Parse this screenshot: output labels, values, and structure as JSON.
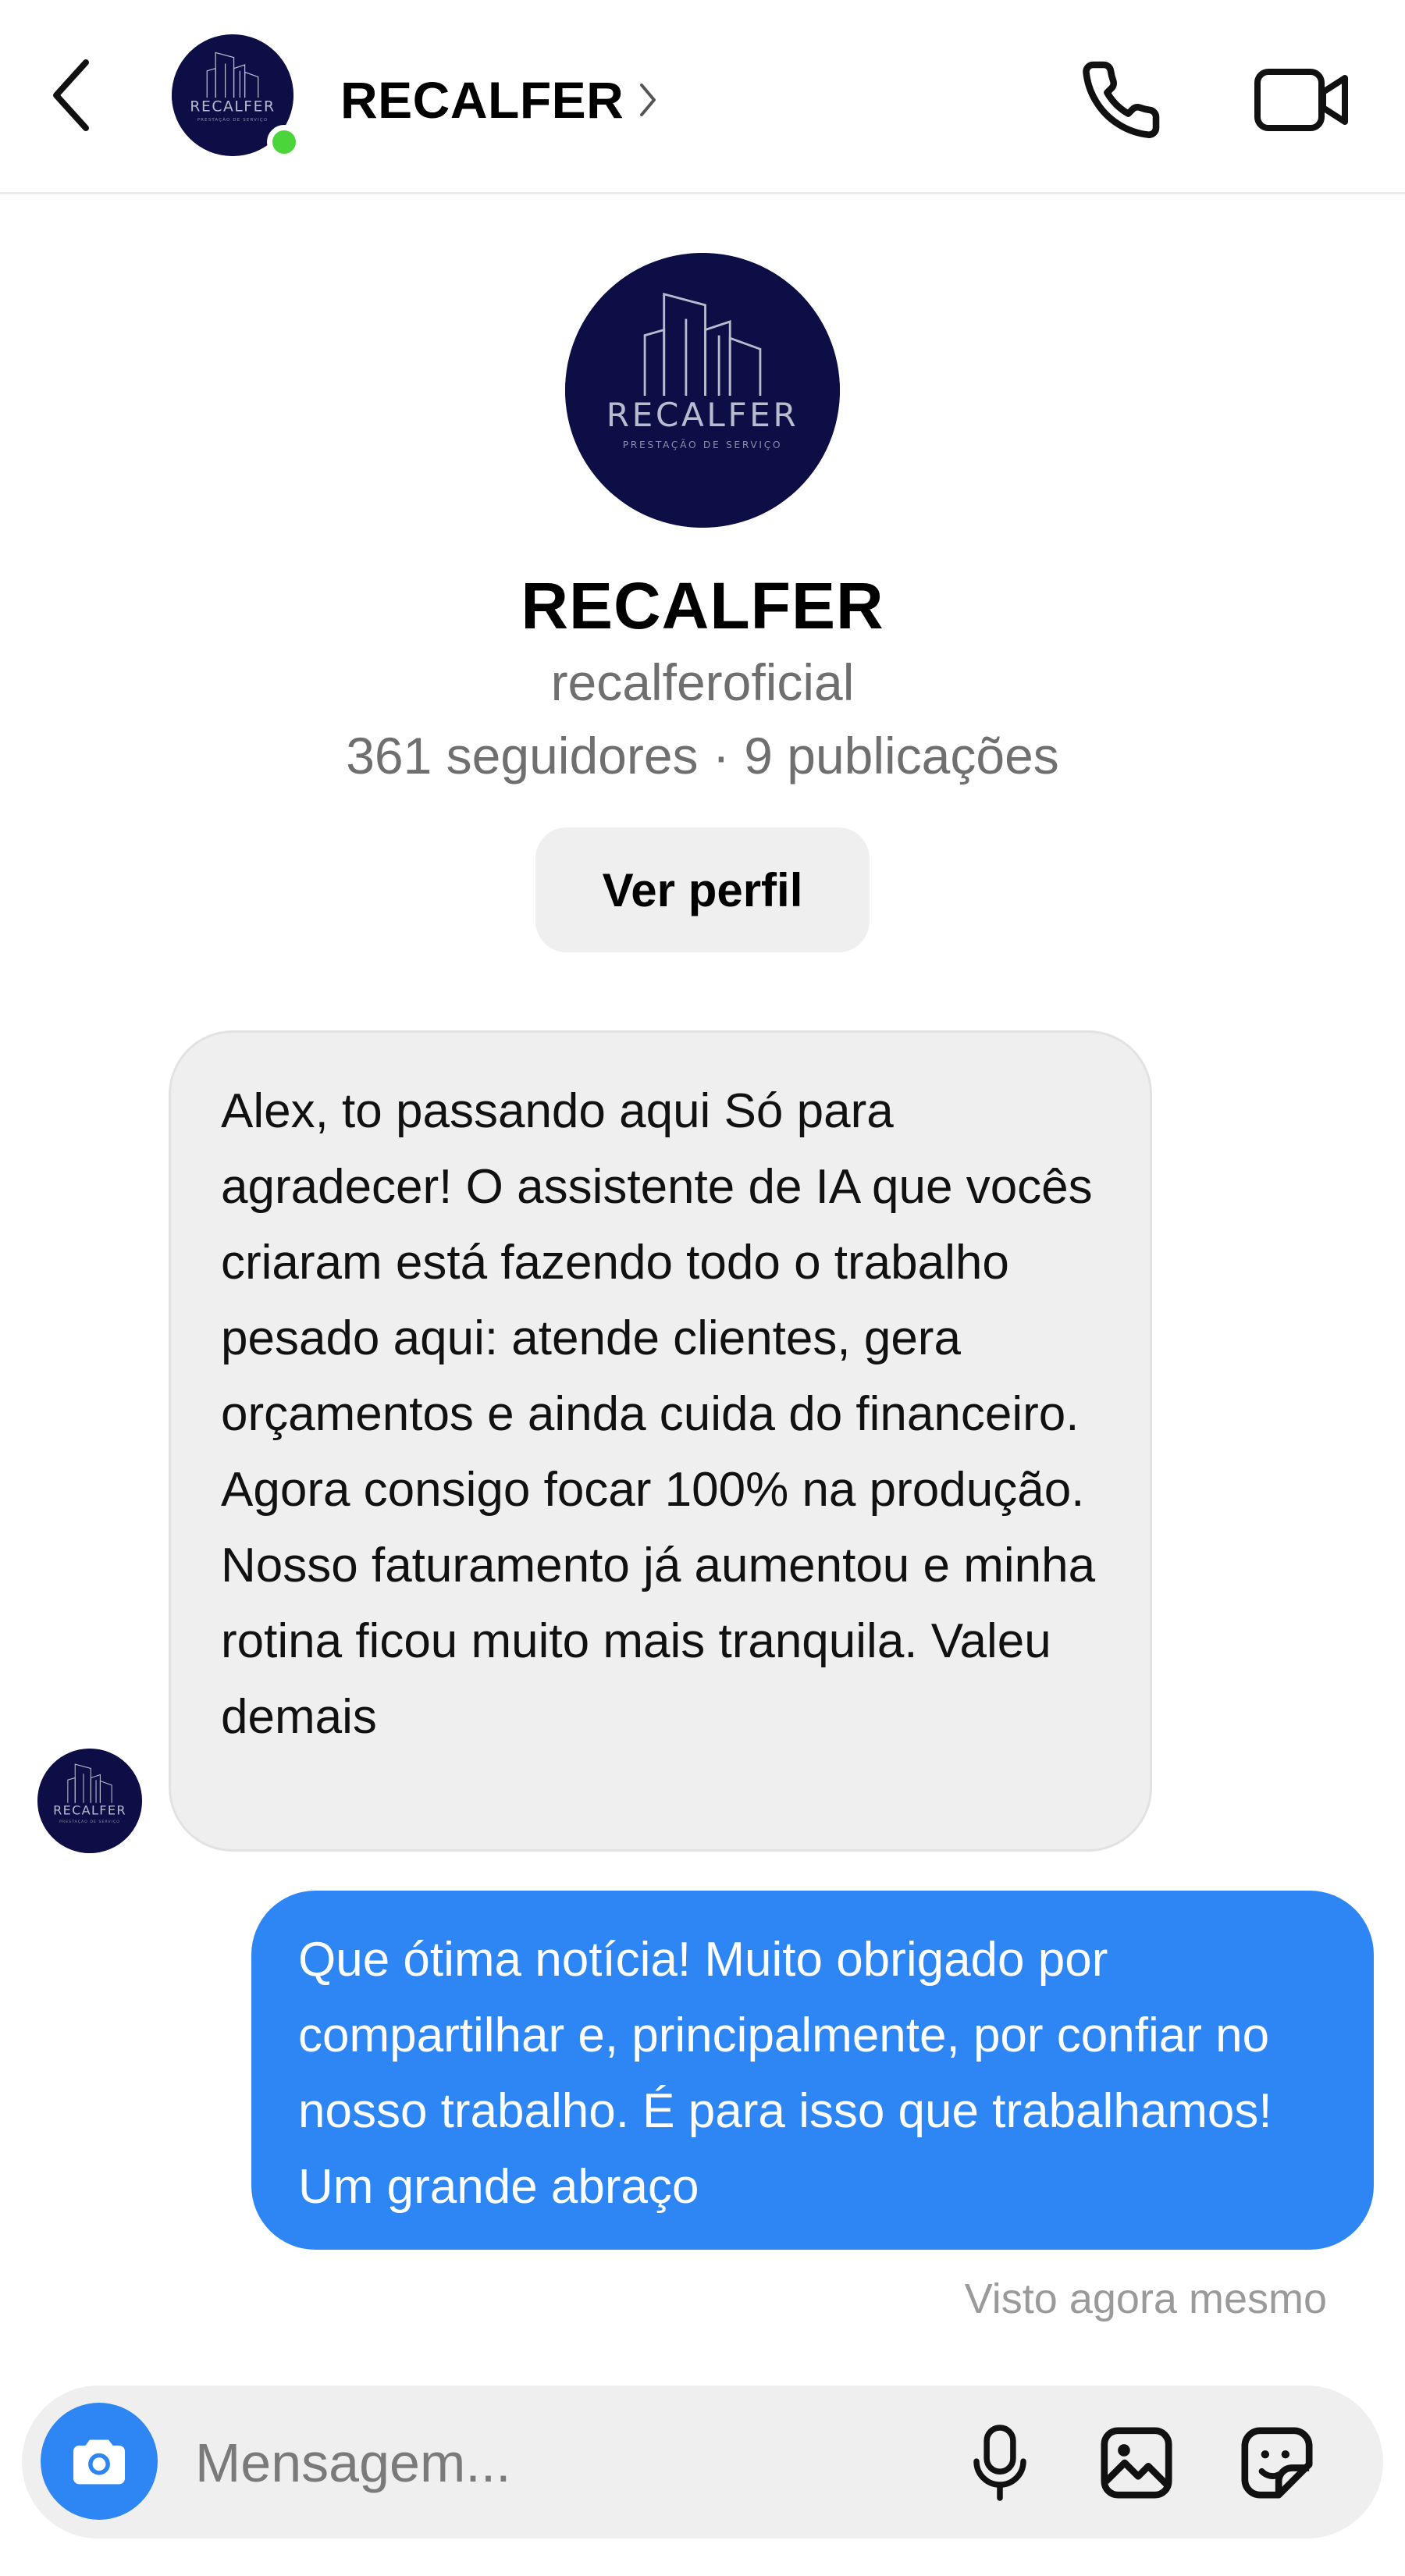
{
  "header": {
    "name": "RECALFER",
    "chevron": "›",
    "online": true,
    "icons": {
      "back": "chevron-left-icon",
      "call": "phone-icon",
      "video": "video-camera-icon"
    }
  },
  "logo": {
    "brand": "RECALFER",
    "tagline": "PRESTAÇÃO DE SERVIÇO"
  },
  "profile": {
    "name": "RECALFER",
    "username": "recalferoficial",
    "stats": "361 seguidores · 9 publicações",
    "view_profile_label": "Ver perfil"
  },
  "messages": [
    {
      "direction": "incoming",
      "text": "Alex, to passando aqui Só para agradecer! O assistente de IA que vocês criaram está fazendo todo o trabalho pesado aqui: atende clientes, gera orçamentos e ainda cuida do financeiro. Agora consigo focar 100% na produção. Nosso faturamento já aumentou e minha rotina ficou muito mais tranquila. Valeu demais"
    },
    {
      "direction": "outgoing",
      "text": "Que ótima notícia! Muito obrigado por compartilhar e, principalmente, por confiar no nosso trabalho. É para isso que trabalhamos! Um grande abraço"
    }
  ],
  "seen_status": "Visto agora mesmo",
  "composer": {
    "placeholder": "Mensagem...",
    "icons": {
      "camera": "camera-icon",
      "mic": "microphone-icon",
      "gallery": "image-icon",
      "sticker": "sticker-icon"
    }
  },
  "colors": {
    "accent_blue": "#2d86f4",
    "online_green": "#4cd53a",
    "avatar_navy": "#0c0e45",
    "bubble_gray": "#efefef",
    "secondary_text": "#6f6f6f"
  }
}
